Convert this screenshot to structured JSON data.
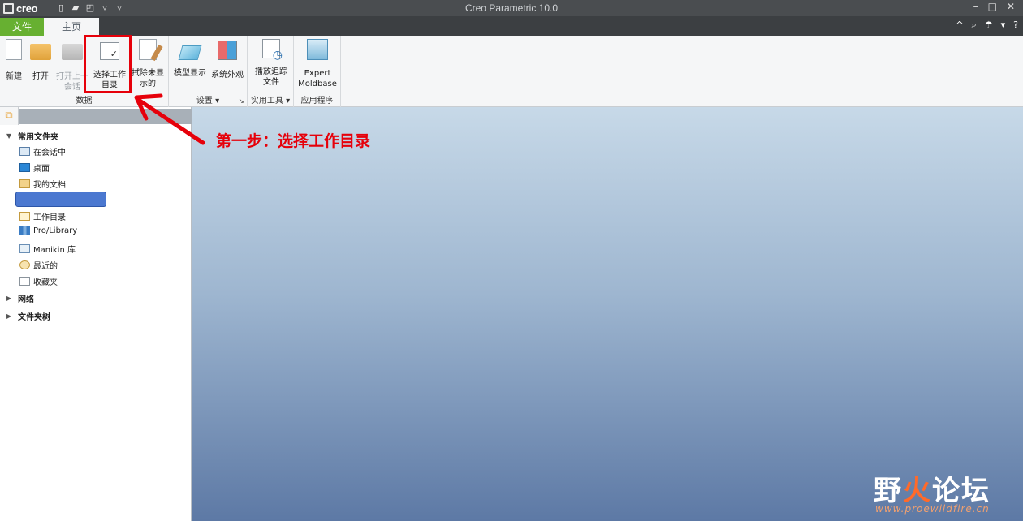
{
  "titlebar": {
    "logo": "creo",
    "app_title": "Creo Parametric 10.0",
    "qat_icons": [
      "new-file-icon",
      "open-folder-icon",
      "window-icon",
      "dropdown-icon",
      "customize-icon"
    ],
    "window_controls": [
      "–",
      "□",
      "✕"
    ]
  },
  "tabs": {
    "file": "文件",
    "home": "主页",
    "right_icons": [
      "^",
      "⌕",
      "☂",
      "▾",
      "?"
    ]
  },
  "ribbon": {
    "groups": {
      "data": "数据",
      "settings": "设置 ▾",
      "utilities": "实用工具 ▾",
      "apps": "应用程序",
      "settings_launcher": "↘"
    },
    "buttons": {
      "new": "新建",
      "open": "打开",
      "open_last_line1": "打开上一",
      "open_last_line2": "会话",
      "select_workdir_line1": "选择工作",
      "select_workdir_line2": "目录",
      "erase_line1": "拭除未显",
      "erase_line2": "示的",
      "model_display": "模型显示",
      "system_appearance": "系统外观",
      "play_trail_line1": "播放追踪",
      "play_trail_line2": "文件",
      "expert_line1": "Expert",
      "expert_line2": "Moldbase"
    }
  },
  "navigator": {
    "common_folders": "常用文件夹",
    "items": [
      {
        "label": "在会话中",
        "icon": "in-session-icon"
      },
      {
        "label": "桌面",
        "icon": "desktop-icon"
      },
      {
        "label": "我的文档",
        "icon": "my-documents-icon"
      },
      {
        "label": "",
        "icon": ""
      },
      {
        "label": "工作目录",
        "icon": "working-directory-icon"
      },
      {
        "label": "Pro/Library",
        "icon": "library-icon"
      },
      {
        "label": "Manikin 库",
        "icon": "manikin-library-icon"
      },
      {
        "label": "最近的",
        "icon": "recent-icon"
      },
      {
        "label": "收藏夹",
        "icon": "favorites-icon"
      }
    ],
    "network": "网络",
    "folder_tree": "文件夹树"
  },
  "annotation": {
    "text": "第一步：选择工作目录"
  },
  "watermark": {
    "title_part1": "野",
    "title_flame": "火",
    "title_part2": "论坛",
    "url": "www.proewildfire.cn"
  },
  "colors": {
    "file_tab": "#67b031",
    "annotation_red": "#e6000a",
    "selected_item": "#4b78d0"
  }
}
